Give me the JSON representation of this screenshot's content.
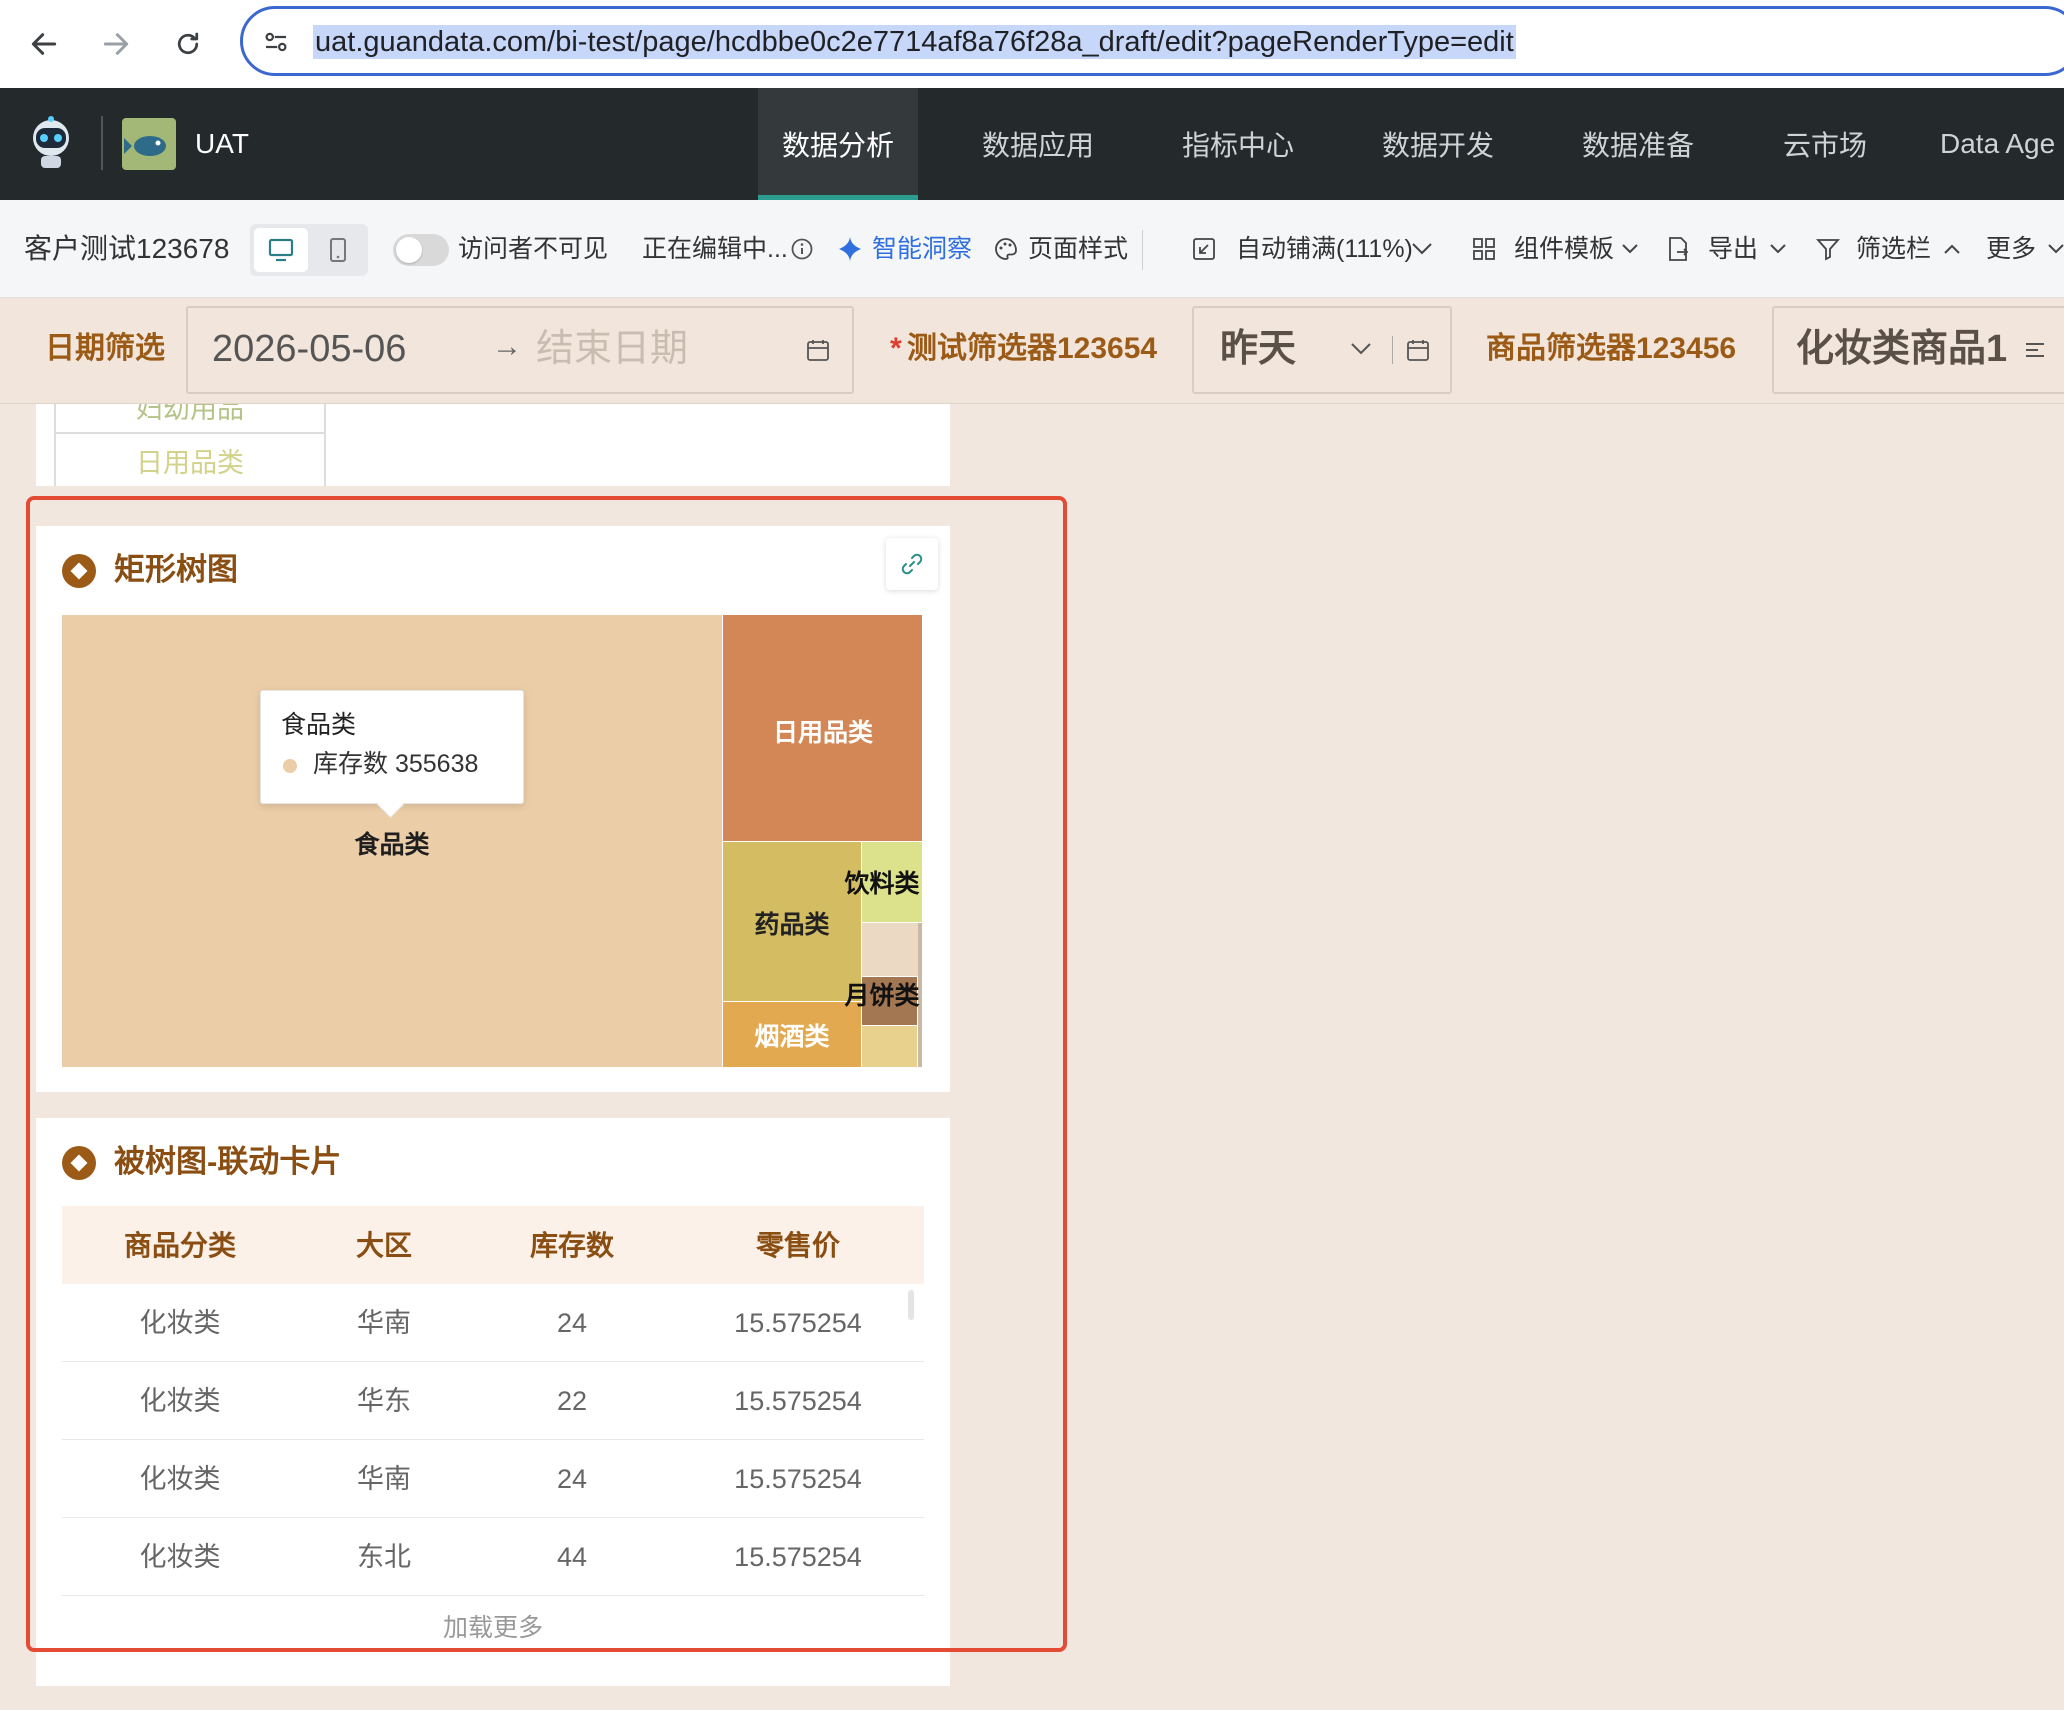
{
  "browser": {
    "url": "uat.guandata.com/bi-test/page/hcdbbe0c2e7714af8a76f28a_draft/edit?pageRenderType=edit"
  },
  "app": {
    "name": "UAT",
    "nav": [
      "数据分析",
      "数据应用",
      "指标中心",
      "数据开发",
      "数据准备",
      "云市场",
      "Data Age"
    ],
    "active_nav": "数据分析",
    "accent_color": "#2a9d8f"
  },
  "toolbar": {
    "page_title": "客户测试123678",
    "visibility_label": "访问者不可见",
    "editing_status": "正在编辑中...",
    "smart_insight": "智能洞察",
    "page_style": "页面样式",
    "auto_fit": "自动铺满(111%)",
    "component_template": "组件模板",
    "export": "导出",
    "filter_bar": "筛选栏",
    "more": "更多"
  },
  "filters": {
    "date_label": "日期筛选",
    "date_start": "2026-05-06",
    "date_end_placeholder": "结束日期",
    "test_filter_required": "*",
    "test_filter_label": "测试筛选器123654",
    "test_filter_value": "昨天",
    "product_filter_label": "商品筛选器123456",
    "product_filter_value": "化妆类商品1"
  },
  "prev_card": {
    "rows": [
      "妇幼用品",
      "日用品类"
    ]
  },
  "treemap_card": {
    "title": "矩形树图",
    "tooltip": {
      "category": "食品类",
      "measure": "库存数",
      "value": "355638"
    },
    "labels": {
      "food": "食品类",
      "daily": "日用品类",
      "medicine": "药品类",
      "drinks": "饮料类",
      "mooncake": "月饼类",
      "tobacco": "烟酒类"
    }
  },
  "chart_data": {
    "type": "treemap",
    "measure": "库存数",
    "items": [
      {
        "name": "食品类",
        "value": 355638,
        "color": "#ebcda7"
      },
      {
        "name": "日用品类",
        "color": "#d38756"
      },
      {
        "name": "药品类",
        "color": "#d4bc62"
      },
      {
        "name": "烟酒类",
        "color": "#e2a950"
      },
      {
        "name": "饮料类",
        "color": "#dce28b"
      },
      {
        "name": "月饼类",
        "color": "#a27752"
      }
    ]
  },
  "table_card": {
    "title": "被树图-联动卡片",
    "columns": [
      "商品分类",
      "大区",
      "库存数",
      "零售价"
    ],
    "rows": [
      [
        "化妆类",
        "华南",
        "24",
        "15.575254"
      ],
      [
        "化妆类",
        "华东",
        "22",
        "15.575254"
      ],
      [
        "化妆类",
        "华南",
        "24",
        "15.575254"
      ],
      [
        "化妆类",
        "东北",
        "44",
        "15.575254"
      ]
    ],
    "load_more": "加载更多"
  }
}
